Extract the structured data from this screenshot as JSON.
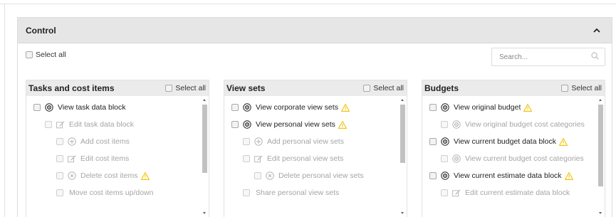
{
  "panel": {
    "title": "Control"
  },
  "global": {
    "select_all_label": "Select all",
    "search_placeholder": "Search..."
  },
  "columns": [
    {
      "title": "Tasks and cost items",
      "select_all_label": "Select all",
      "items": [
        {
          "label": "View task data block",
          "icon": "view-icon",
          "warning": false,
          "disabled": false
        },
        {
          "label": "Edit task data block",
          "icon": "edit-icon",
          "warning": false,
          "disabled": true
        },
        {
          "label": "Add cost items",
          "icon": "add-icon",
          "warning": false,
          "disabled": true
        },
        {
          "label": "Edit cost items",
          "icon": "edit-icon",
          "warning": false,
          "disabled": true
        },
        {
          "label": "Delete cost items",
          "icon": "delete-icon",
          "warning": true,
          "disabled": true
        },
        {
          "label": "Move cost items up/down",
          "icon": "",
          "warning": false,
          "disabled": true
        }
      ]
    },
    {
      "title": "View sets",
      "select_all_label": "Select all",
      "items": [
        {
          "label": "View corporate view sets",
          "icon": "view-icon",
          "warning": true,
          "disabled": false
        },
        {
          "label": "View personal view sets",
          "icon": "view-icon",
          "warning": true,
          "disabled": false
        },
        {
          "label": "Add personal view sets",
          "icon": "add-icon",
          "warning": false,
          "disabled": true
        },
        {
          "label": "Edit personal view sets",
          "icon": "edit-icon",
          "warning": false,
          "disabled": true
        },
        {
          "label": "Delete personal view sets",
          "icon": "delete-icon",
          "warning": false,
          "disabled": true
        },
        {
          "label": "Share personal view sets",
          "icon": "",
          "warning": false,
          "disabled": true
        }
      ]
    },
    {
      "title": "Budgets",
      "select_all_label": "Select all",
      "items": [
        {
          "label": "View original budget",
          "icon": "view-icon",
          "warning": true,
          "disabled": false
        },
        {
          "label": "View original budget cost categories",
          "icon": "view-icon",
          "warning": false,
          "disabled": true
        },
        {
          "label": "View current budget data block",
          "icon": "view-icon",
          "warning": true,
          "disabled": false
        },
        {
          "label": "View current budget cost categories",
          "icon": "view-icon",
          "warning": false,
          "disabled": true
        },
        {
          "label": "View current estimate data block",
          "icon": "view-icon",
          "warning": true,
          "disabled": false
        },
        {
          "label": "Edit current estimate data block",
          "icon": "edit-icon",
          "warning": false,
          "disabled": true
        }
      ]
    }
  ],
  "colors": {
    "warning": "#f2c200",
    "header_bg": "#e6e6e6",
    "disabled_text": "#a5a5a5"
  }
}
